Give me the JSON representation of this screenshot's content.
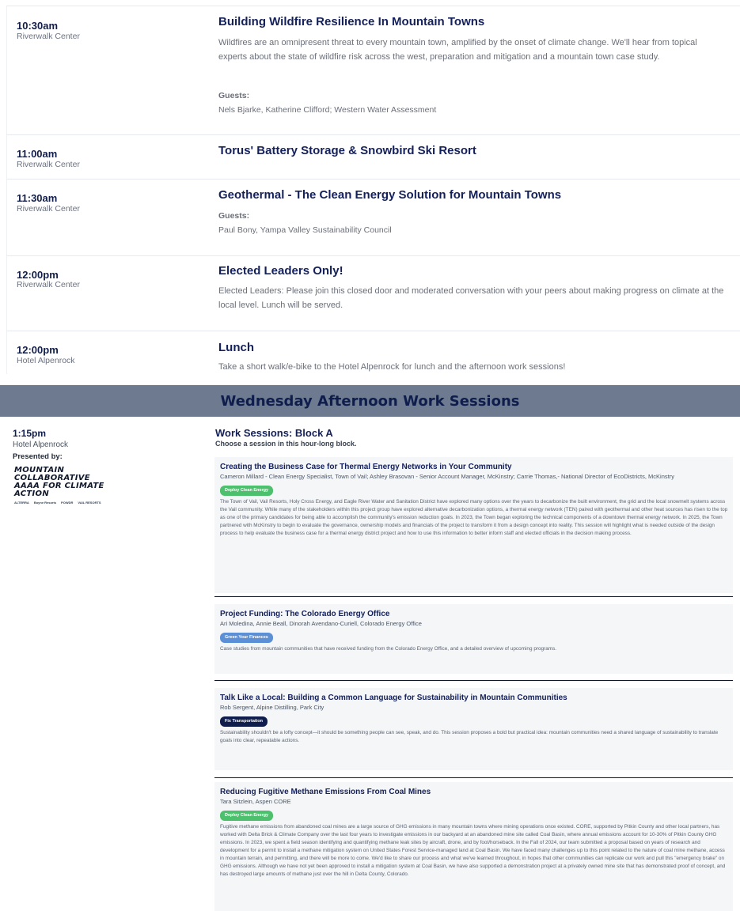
{
  "events": [
    {
      "time": "10:30am",
      "location": "Riverwalk Center",
      "title": "Building Wildfire Resilience In Mountain Towns",
      "description": "Wildfires are an omnipresent threat to every mountain town, amplified by the onset of climate change. We'll hear from topical experts about the state of wildfire risk across the west, preparation and mitigation and a mountain town case study.",
      "guests_label": "Guests:",
      "guests": "Nels Bjarke, Katherine Clifford; Western Water Assessment"
    },
    {
      "time": "11:00am",
      "location": "Riverwalk Center",
      "title": "Torus' Battery Storage & Snowbird Ski Resort"
    },
    {
      "time": "11:30am",
      "location": "Riverwalk Center",
      "title": "Geothermal - The Clean Energy Solution for Mountain Towns",
      "guests_label": "Guests:",
      "guests": "Paul Bony, Yampa Valley Sustainability Council"
    },
    {
      "time": "12:00pm",
      "location": "Riverwalk Center",
      "title": "Elected Leaders Only!",
      "description": "Elected Leaders: Please join this closed door and moderated  conversation with your peers about making progress on climate at the local level. Lunch will be served."
    },
    {
      "time": "12:00pm",
      "location": "Hotel Alpenrock",
      "title": "Lunch",
      "description": "Take a short walk/e-bike to the Hotel Alpenrock for lunch and the afternoon work sessions!"
    }
  ],
  "banner": "Wednesday Afternoon Work Sessions",
  "work_sessions": {
    "time": "1:15pm",
    "location": "Hotel Alpenrock",
    "presented_by": "Presented by:",
    "logo": {
      "line1": "MOUNTAIN COLLABORATIVE",
      "line2": "AAAA FOR CLIMATE ACTION",
      "partners": [
        "ALTERRA",
        "Boyne Resorts",
        "POWDR",
        "VAIL RESORTS"
      ]
    },
    "block_title": "Work Sessions: Block A",
    "block_subtitle": "Choose a session in this hour-long block.",
    "sessions": [
      {
        "title": "Creating the Business Case for Thermal Energy Networks in Your Community",
        "speakers": "Cameron Millard - Clean Energy Specialist, Town of Vail; Ashley Brasovan - Senior Account Manager, McKinstry; Carrie Thomas,- National Director of EcoDistricts, McKinstry",
        "tag": "Deploy Clean Energy",
        "tag_color": "#4cc06c",
        "description": "The Town of Vail, Vail Resorts, Holy Cross Energy, and Eagle River Water and Sanitation District have explored many options over the years to decarbonize the built environment, the grid and the local snowmelt systems across the Vail community. While many of the stakeholders within this project group have explored alternative decarbonization options, a thermal energy network (TEN) paired with geothermal and other heat sources has risen to the top as one of the primary candidates for being able to accomplish the community's emission reduction goals. In 2023, the Town began exploring the technical components of a downtown thermal energy network. In 2025, the Town partnered with McKinstry to begin to evaluate the governance, ownership models and financials of the project to transform it from a design concept into reality. This session will highlight what is needed outside of the design process to help evaluate the business case for a thermal energy district project and how to use this information to better inform staff and elected officials in the decision making process."
      },
      {
        "title": "Project Funding: The Colorado Energy Office",
        "speakers": "Ari Moledina, Annie Beall, Dinorah Avendano-Curiell, Colorado Energy Office",
        "tag": "Green Your Finances",
        "tag_color": "#5b8fd6",
        "description": "Case studies from mountain communities that have received funding from the Colorado Energy Office, and a detailed overview of upcoming programs."
      },
      {
        "title": "Talk Like a Local: Building a Common Language for Sustainability in Mountain Communities",
        "speakers": "Rob Sergent, Alpine Distilling, Park City",
        "tag": "Fix Transportation",
        "tag_color": "#0f1d4d",
        "description": "Sustainability shouldn't be a lofty concept—it should be something people can see, speak, and do. This session proposes a bold but practical idea: mountain communities need a shared language of sustainability to translate goals into clear, repeatable actions."
      },
      {
        "title": "Reducing Fugitive Methane Emissions From Coal Mines",
        "speakers": "Tara Sitzlein, Aspen CORE",
        "tag": "Deploy Clean Energy",
        "tag_color": "#4cc06c",
        "description": "Fugitive methane emissions from abandoned coal mines are a large source of GHG emissions in many mountain towns where mining operations once existed. CORE, supported by Pitkin County and other local partners, has worked with Delta Brick & Climate Company over the last four years to investigate emissions in our backyard at an abandoned mine site called Coal Basin, where annual emissions account for 10-30% of Pitkin County GHG emissions. In 2023, we spent a field season identifying and quantifying methane leak sites by aircraft, drone, and by foot/horseback. In the Fall of 2024, our team submitted a proposal based on years of research and development for a permit to install a methane mitigation system on United States Forest Service-managed land at Coal Basin. We have faced many challenges up to this point related to the nature of coal mine methane, access in mountain terrain, and permitting, and there will be more to come. We'd like to share our process and what we've learned throughout, in hopes that other communities can replicate our work and pull this \"emergency brake\" on GHG emissions. Although we have not yet been approved to install a mitigation system at Coal Basin, we have also supported a demonstration project at a privately owned mine site that has demonstrated proof of concept, and has destroyed large amounts of methane just over the hill in Delta County, Colorado."
      }
    ]
  }
}
